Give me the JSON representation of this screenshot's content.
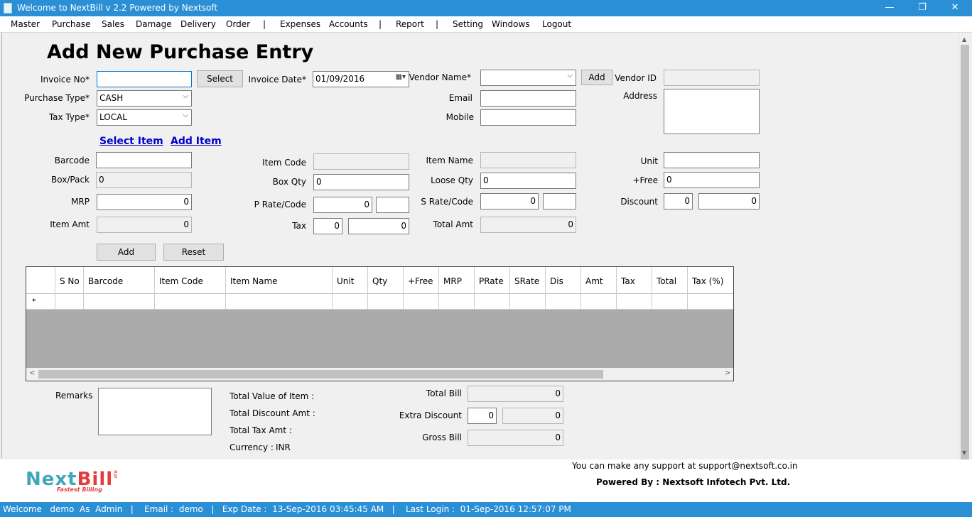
{
  "window": {
    "title": "Welcome to NextBill v 2.2 Powered by Nextsoft",
    "minimize": "—",
    "restore": "❐",
    "close": "✕"
  },
  "menu": [
    "Master",
    "Purchase",
    "Sales",
    "Damage",
    "Delivery",
    "Order",
    "|",
    "Expenses",
    "Accounts",
    "|",
    "Report",
    "|",
    "Setting",
    "Windows",
    "Logout"
  ],
  "page": {
    "title": "Add New Purchase Entry"
  },
  "invoice": {
    "invoice_no_label": "Invoice No*",
    "invoice_no_value": "",
    "select_button": "Select",
    "invoice_date_label": "Invoice Date*",
    "invoice_date_value": "01/09/2016",
    "purchase_type_label": "Purchase Type*",
    "purchase_type_value": "CASH",
    "tax_type_label": "Tax Type*",
    "tax_type_value": "LOCAL"
  },
  "vendor": {
    "name_label": "Vendor Name*",
    "name_value": "",
    "add_button": "Add",
    "id_label": "Vendor ID",
    "id_value": "",
    "email_label": "Email",
    "email_value": "",
    "mobile_label": "Mobile",
    "mobile_value": "",
    "address_label": "Address",
    "address_value": ""
  },
  "links": {
    "select_item": "Select Item",
    "add_item": "Add Item"
  },
  "item": {
    "barcode_label": "Barcode",
    "barcode_value": "",
    "box_pack_label": "Box/Pack",
    "box_pack_value": "0",
    "mrp_label": "MRP",
    "mrp_value": "0",
    "item_amt_label": "Item Amt",
    "item_amt_value": "0",
    "item_code_label": "Item Code",
    "item_code_value": "",
    "box_qty_label": "Box Qty",
    "box_qty_value": "0",
    "p_rate_label": "P Rate/Code",
    "p_rate_value": "0",
    "p_code_value": "",
    "tax_label": "Tax",
    "tax_value1": "0",
    "tax_value2": "0",
    "item_name_label": "Item Name",
    "item_name_value": "",
    "loose_qty_label": "Loose Qty",
    "loose_qty_value": "0",
    "s_rate_label": "S Rate/Code",
    "s_rate_value": "0",
    "s_code_value": "",
    "total_amt_label": "Total Amt",
    "total_amt_value": "0",
    "unit_label": "Unit",
    "unit_value": "",
    "free_label": "+Free",
    "free_value": "0",
    "discount_label": "Discount",
    "discount_value1": "0",
    "discount_value2": "0",
    "add_button": "Add",
    "reset_button": "Reset"
  },
  "grid": {
    "columns": [
      "S No",
      "Barcode",
      "Item Code",
      "Item Name",
      "Unit",
      "Qty",
      "+Free",
      "MRP",
      "PRate",
      "SRate",
      "Dis",
      "Amt",
      "Tax",
      "Total",
      "Tax (%)"
    ],
    "new_row_marker": "*"
  },
  "summary": {
    "remarks_label": "Remarks",
    "remarks_value": "",
    "total_value_label": "Total Value of Item :",
    "total_discount_label": "Total Discount Amt :",
    "total_tax_label": "Total Tax Amt :",
    "currency_label": "Currency :",
    "currency_value": "INR",
    "total_bill_label": "Total Bill",
    "total_bill_value": "0",
    "extra_discount_label": "Extra Discount",
    "extra_discount_value1": "0",
    "extra_discount_value2": "0",
    "gross_bill_label": "Gross Bill",
    "gross_bill_value": "0"
  },
  "footer": {
    "logo_part1": "Next",
    "logo_part2": "Bill",
    "logo_tagline": "Fastest Billing",
    "logo_rw": "RW",
    "support_text": "You can make any support at support@nextsoft.co.in",
    "powered_by": "Powered By : Nextsoft Infotech Pvt. Ltd."
  },
  "status": {
    "text": "Welcome   demo  As  Admin   |    Email :  demo   |   Exp Date :  13-Sep-2016 03:45:45 AM   |    Last Login :  01-Sep-2016 12:57:07 PM"
  },
  "colors": {
    "titlebar": "#2b8fd6",
    "statusbar": "#2b8fd6",
    "link": "#0000cc",
    "logo_teal": "#3ea8b9",
    "logo_red": "#e23c3c"
  }
}
